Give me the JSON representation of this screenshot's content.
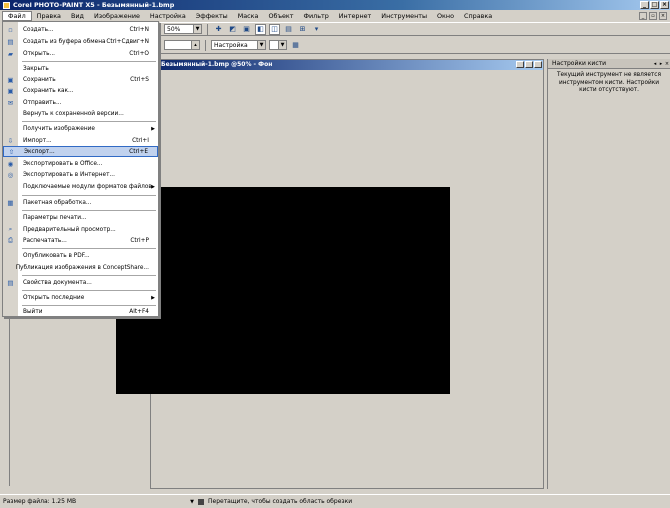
{
  "window": {
    "title": "Corel PHOTO-PAINT X5 - Безымянный-1.bmp"
  },
  "menubar": [
    "Файл",
    "Правка",
    "Вид",
    "Изображение",
    "Настройка",
    "Эффекты",
    "Маска",
    "Объект",
    "Фильтр",
    "Интернет",
    "Инструменты",
    "Окно",
    "Справка"
  ],
  "toolbar": {
    "zoom": "50%",
    "blend_mode": "Настройка"
  },
  "document": {
    "title": "Безымянный-1.bmp @50% - Фон"
  },
  "file_menu": {
    "items": [
      {
        "label": "Создать...",
        "shortcut": "Ctrl+N"
      },
      {
        "label": "Создать из буфера обмена",
        "shortcut": "Ctrl+Сдвиг+N"
      },
      {
        "label": "Открыть...",
        "shortcut": "Ctrl+O"
      },
      {
        "label": "Закрыть",
        "shortcut": ""
      },
      {
        "label": "Сохранить",
        "shortcut": "Ctrl+S"
      },
      {
        "label": "Сохранить как...",
        "shortcut": ""
      },
      {
        "label": "Отправить...",
        "shortcut": ""
      },
      {
        "label": "Вернуть к сохраненной версии...",
        "shortcut": ""
      },
      {
        "label": "Получить изображение",
        "shortcut": ""
      },
      {
        "label": "Импорт...",
        "shortcut": "Ctrl+I"
      },
      {
        "label": "Экспорт...",
        "shortcut": "Ctrl+E"
      },
      {
        "label": "Экспортировать в Office...",
        "shortcut": ""
      },
      {
        "label": "Экспортировать в Интернет...",
        "shortcut": ""
      },
      {
        "label": "Подключаемые модули форматов файлов",
        "shortcut": ""
      },
      {
        "label": "Пакетная обработка...",
        "shortcut": ""
      },
      {
        "label": "Параметры печати...",
        "shortcut": ""
      },
      {
        "label": "Предварительный просмотр...",
        "shortcut": ""
      },
      {
        "label": "Распечатать...",
        "shortcut": "Ctrl+P"
      },
      {
        "label": "Опубликовать в PDF...",
        "shortcut": ""
      },
      {
        "label": "Публикация изображения в ConceptShare...",
        "shortcut": ""
      },
      {
        "label": "Свойства документа...",
        "shortcut": ""
      },
      {
        "label": "Открыть последние",
        "shortcut": ""
      },
      {
        "label": "Выйти",
        "shortcut": "Alt+F4"
      }
    ]
  },
  "dock": {
    "title": "Настройки кисти",
    "message": "Текущий инструмент не является инструментом кисти. Настройки кисти отсутствуют."
  },
  "status": {
    "file_size": "Размер файла: 1.25 MB",
    "hint": "Перетащите, чтобы создать область обрезки"
  },
  "colors": {
    "highlight": "#c1d2ee",
    "title_bar": "#0a246a"
  }
}
